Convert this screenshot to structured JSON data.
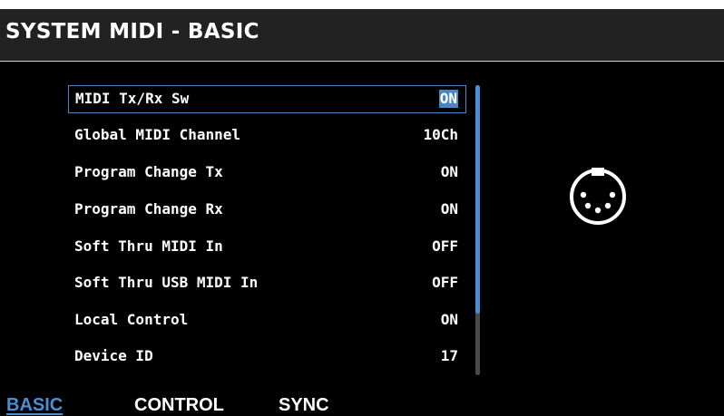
{
  "header": {
    "title": "SYSTEM MIDI - BASIC"
  },
  "params": [
    {
      "label": "MIDI Tx/Rx Sw",
      "value": "ON",
      "selected": true
    },
    {
      "label": "Global MIDI Channel",
      "value": "10Ch",
      "selected": false
    },
    {
      "label": "Program Change Tx",
      "value": "ON",
      "selected": false
    },
    {
      "label": "Program Change Rx",
      "value": "ON",
      "selected": false
    },
    {
      "label": "Soft Thru MIDI In",
      "value": "OFF",
      "selected": false
    },
    {
      "label": "Soft Thru USB MIDI In",
      "value": "OFF",
      "selected": false
    },
    {
      "label": "Local Control",
      "value": "ON",
      "selected": false
    },
    {
      "label": "Device ID",
      "value": "17",
      "selected": false
    }
  ],
  "icons": {
    "side": "midi-connector-icon"
  },
  "tabs": [
    {
      "label": "BASIC",
      "active": true
    },
    {
      "label": "CONTROL",
      "active": false
    },
    {
      "label": "SYNC",
      "active": false
    }
  ],
  "colors": {
    "accent": "#4a86c6",
    "scroll_thumb": "#4a8fd6",
    "scroll_track": "#4a4a4a",
    "background": "#000000",
    "title_bar": "#222222",
    "text": "#ffffff"
  }
}
